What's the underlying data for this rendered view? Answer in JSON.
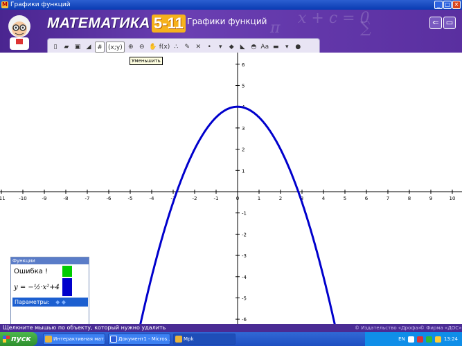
{
  "window": {
    "title": "Графики функций",
    "min": "_",
    "max": "□",
    "close": "✕"
  },
  "header": {
    "logo_text": "МАТЕМАТИКА",
    "logo_num": "5-11",
    "title": "Графики функций",
    "deco": [
      "x + c = 0",
      "π",
      "∑"
    ],
    "back_btn": "⇐",
    "window_btn": "▭"
  },
  "toolbar": {
    "items": [
      {
        "name": "new-icon",
        "glyph": "▯"
      },
      {
        "name": "open-icon",
        "glyph": "▰"
      },
      {
        "name": "save-icon",
        "glyph": "▣"
      },
      {
        "name": "eraser-icon",
        "glyph": "◢"
      },
      {
        "name": "grid-icon",
        "glyph": "#"
      },
      {
        "name": "coords-label",
        "glyph": "(x;y)"
      },
      {
        "name": "zoom-in-icon",
        "glyph": "⊕"
      },
      {
        "name": "zoom-out-icon",
        "glyph": "⊖"
      },
      {
        "name": "pan-hand-icon",
        "glyph": "✋"
      },
      {
        "name": "function-icon",
        "glyph": "f(x)"
      },
      {
        "name": "points-icon",
        "glyph": "∴"
      },
      {
        "name": "pencil-icon",
        "glyph": "✎"
      },
      {
        "name": "delete-icon",
        "glyph": "✕"
      },
      {
        "name": "point-style-icon",
        "glyph": "•"
      },
      {
        "name": "dropdown-arrow-icon",
        "glyph": "▾"
      },
      {
        "name": "eraser2-icon",
        "glyph": "◆"
      },
      {
        "name": "ruler-icon",
        "glyph": "◣"
      },
      {
        "name": "protractor-icon",
        "glyph": "◓"
      },
      {
        "name": "text-icon",
        "glyph": "Aa"
      },
      {
        "name": "line-color-icon",
        "glyph": "▬"
      },
      {
        "name": "color-dropdown-icon",
        "glyph": "▾"
      },
      {
        "name": "palette-icon",
        "glyph": "●"
      }
    ],
    "tooltip": "Уменьшить"
  },
  "chart_data": {
    "type": "line",
    "xlim": [
      -11,
      10
    ],
    "ylim": [
      -6,
      6
    ],
    "xticks": [
      -11,
      -10,
      -9,
      -8,
      -7,
      -6,
      -5,
      -4,
      -3,
      -2,
      -1,
      0,
      1,
      2,
      3,
      4,
      5,
      6,
      7,
      8,
      9,
      10
    ],
    "yticks": [
      -6,
      -5,
      -4,
      -3,
      -2,
      -1,
      1,
      2,
      3,
      4,
      5,
      6
    ],
    "series": [
      {
        "function": "-0.5*x^2+4",
        "color": "#0000cc"
      }
    ],
    "grid": false
  },
  "panel": {
    "title": "Функции",
    "error": "Ошибка !",
    "equation": "y = −½·x²+4",
    "error_color": "#00cc00",
    "eq_color": "#0000cc",
    "params": "Параметры:"
  },
  "status": {
    "text": "Щелкните мышью по объекту, который нужно удалить",
    "copy1": "© Издательство «Дрофа»",
    "copy2": "© Фирма «ДОС»"
  },
  "taskbar": {
    "start": "пуск",
    "tasks": [
      "Интерактивная мат...",
      "Документ1 - Micros...",
      "Мрk"
    ],
    "lang": "EN",
    "time": "13:24"
  }
}
